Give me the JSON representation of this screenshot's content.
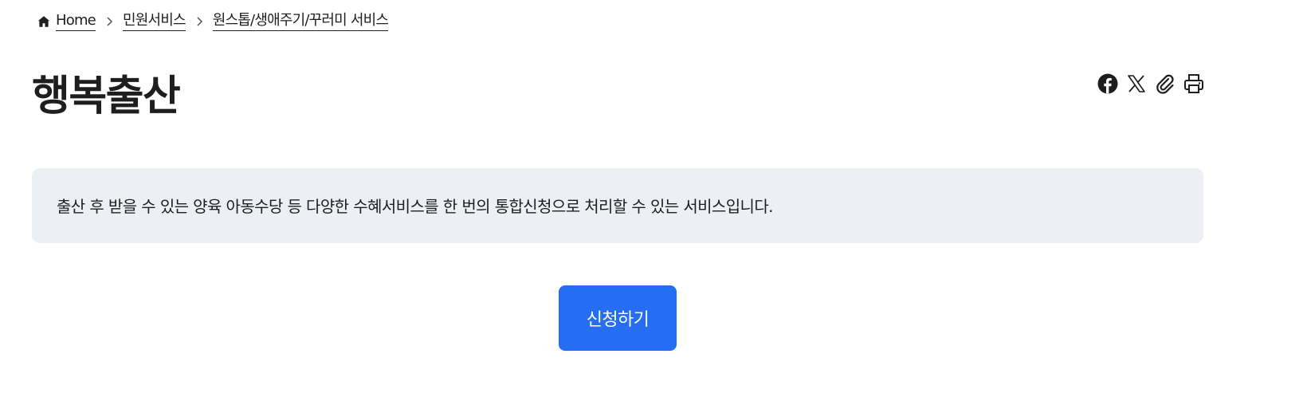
{
  "breadcrumb": {
    "items": [
      {
        "label": "Home",
        "icon": "home-icon"
      },
      {
        "label": "민원서비스"
      },
      {
        "label": "원스톱/생애주기/꾸러미 서비스"
      }
    ],
    "separator_icon": "chevron-right-icon"
  },
  "page": {
    "title": "행복출산",
    "description": "출산 후 받을 수 있는 양육 아동수당 등 다양한 수혜서비스를 한 번의 통합신청으로 처리할 수 있는 서비스입니다."
  },
  "tools": [
    {
      "icon": "facebook-icon"
    },
    {
      "icon": "x-twitter-icon"
    },
    {
      "icon": "paperclip-icon"
    },
    {
      "icon": "print-icon"
    }
  ],
  "actions": {
    "apply_label": "신청하기"
  },
  "colors": {
    "primary": "#256ef4",
    "description_bg": "#eceff3",
    "text": "#1e1e1e"
  }
}
